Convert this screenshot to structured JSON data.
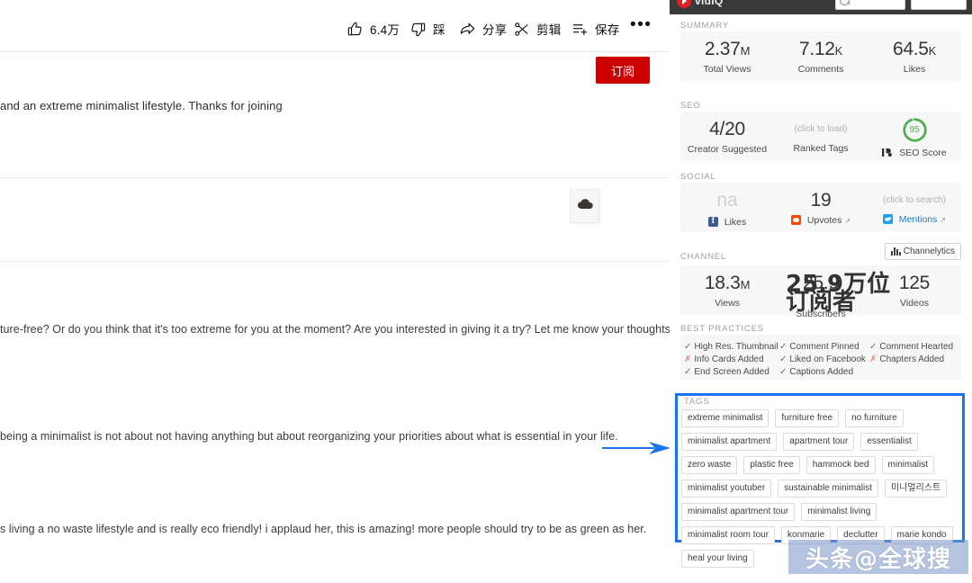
{
  "watch": {
    "actions": [
      {
        "id": "like",
        "icon": "thumbs-up-icon",
        "label": "6.4万"
      },
      {
        "id": "dislike",
        "icon": "thumbs-down-icon",
        "label": "踩"
      },
      {
        "id": "share",
        "icon": "share-arrow-icon",
        "label": "分享"
      },
      {
        "id": "clip",
        "icon": "scissors-icon",
        "label": "剪辑"
      },
      {
        "id": "save",
        "icon": "save-list-icon",
        "label": "保存"
      },
      {
        "id": "more",
        "icon": "more-horizontal-icon",
        "label": "…"
      }
    ],
    "subscribe_label": "订阅",
    "description_line": "and an extreme minimalist lifestyle. Thanks for joining",
    "cloud_icon": "cloud-icon",
    "paragraphs": [
      "ture-free? Or do you think that it's too extreme for you at the moment? Are you interested in giving it a try? Let me know your thoughts and",
      "being a minimalist is not about not having anything but about reorganizing your priorities about what is essential in your life.",
      "s living a no waste lifestyle and is really eco friendly! i applaud her, this is amazing! more people should try to be as green as her."
    ]
  },
  "vidiq": {
    "brand": "vidIQ",
    "header_search_placeholder": "",
    "summary": {
      "title": "SUMMARY",
      "stats": [
        {
          "value": "2.37",
          "suffix": "M",
          "label": "Total Views"
        },
        {
          "value": "7.12",
          "suffix": "K",
          "label": "Comments"
        },
        {
          "value": "64.5",
          "suffix": "K",
          "label": "Likes"
        }
      ]
    },
    "seo": {
      "title": "SEO",
      "creator_suggested_value": "4/20",
      "creator_suggested_label": "Creator Suggested",
      "ranked_tags_hint": "(click to load)",
      "ranked_tags_label": "Ranked Tags",
      "score_value": "95",
      "score_label": "SEO Score",
      "score_color": "#4caf50"
    },
    "social": {
      "title": "SOCIAL",
      "likes_value": "na",
      "likes_label": "Likes",
      "upvotes_value": "19",
      "upvotes_label": "Upvotes",
      "mentions_hint": "(click to search)",
      "mentions_label": "Mentions"
    },
    "channel": {
      "title": "CHANNEL",
      "channelytics_label": "Channelytics",
      "views_value": "18.3",
      "views_suffix": "M",
      "views_label": "Views",
      "subscribers_value": "25.9",
      "subscribers_label": "Subscribers",
      "videos_value": "125",
      "videos_label": "Videos"
    },
    "best_practices": {
      "title": "BEST PRACTICES",
      "items": [
        {
          "label": "High Res. Thumbnail",
          "ok": true
        },
        {
          "label": "Comment Pinned",
          "ok": true
        },
        {
          "label": "Comment Hearted",
          "ok": true
        },
        {
          "label": "Info Cards Added",
          "ok": false
        },
        {
          "label": "Liked on Facebook",
          "ok": true
        },
        {
          "label": "Chapters Added",
          "ok": false
        },
        {
          "label": "End Screen Added",
          "ok": true
        },
        {
          "label": "Captions Added",
          "ok": true
        }
      ]
    },
    "tags": {
      "title": "TAGS",
      "highlight_color": "#1a73e8",
      "rows": [
        [
          "extreme minimalist",
          "furniture free",
          "no furniture"
        ],
        [
          "minimalist apartment",
          "apartment tour",
          "essentialist"
        ],
        [
          "zero waste",
          "plastic free",
          "hammock bed",
          "minimalist"
        ],
        [
          "minimalist youtuber",
          "sustainable minimalist",
          "미니멀리스트"
        ],
        [
          "minimalist apartment tour",
          "minimalist living"
        ],
        [
          "minimalist room tour",
          "konmarie",
          "declutter",
          "marie kondo"
        ],
        [
          "heal your living"
        ]
      ]
    }
  },
  "annotations": {
    "arrow_color": "#1a73e8",
    "overlay_text_1": "25.9万位",
    "overlay_text_2": "订阅者",
    "watermark": "头条@全球搜"
  }
}
